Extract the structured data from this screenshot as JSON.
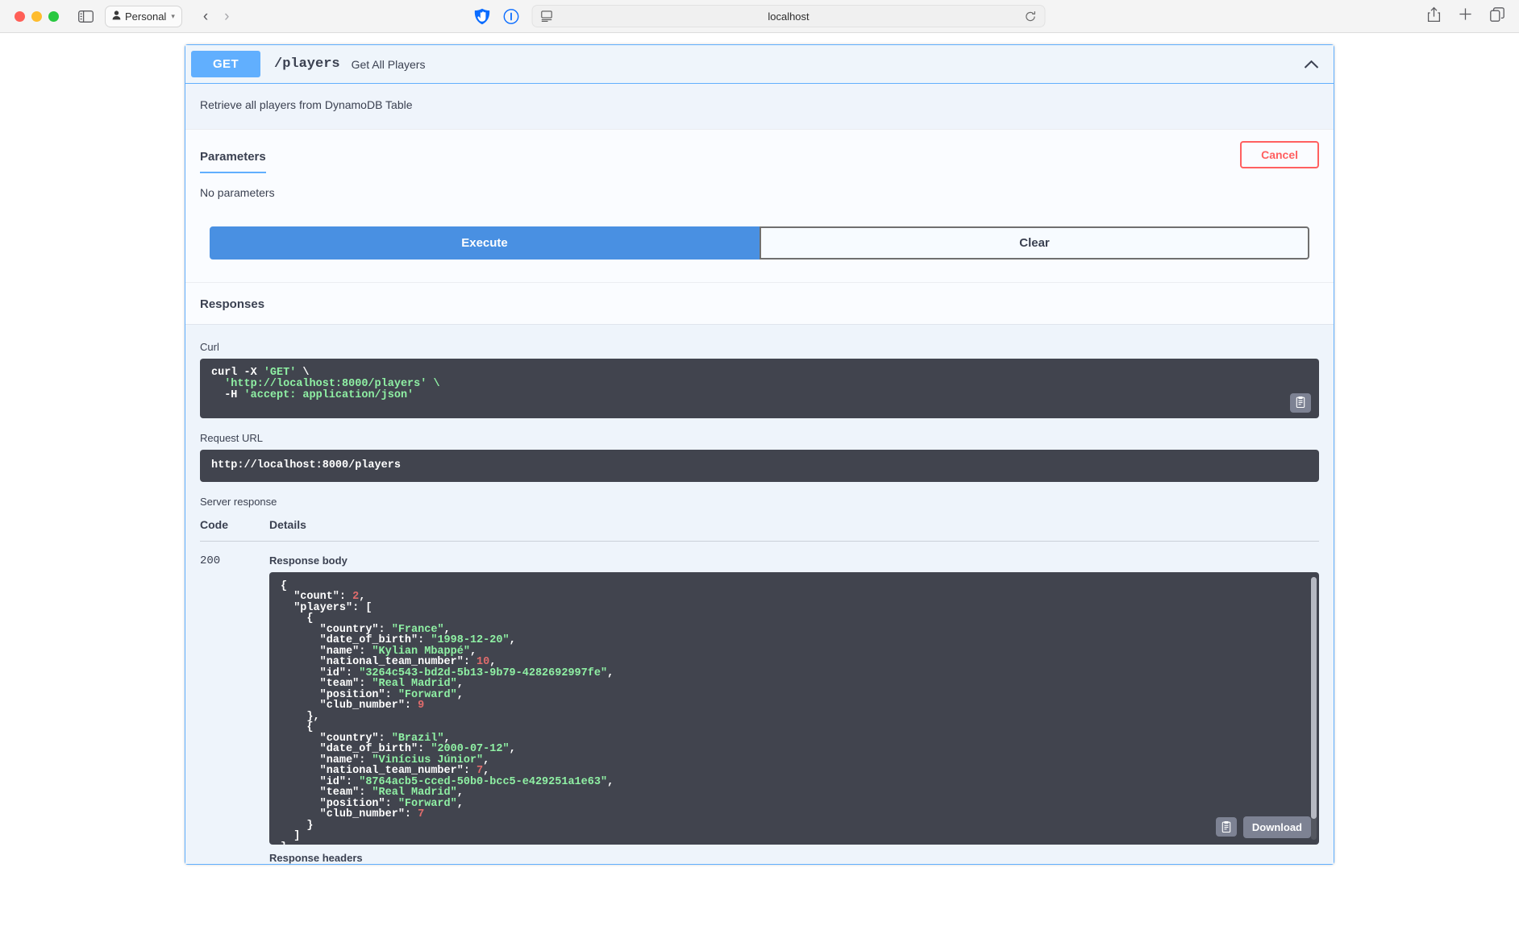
{
  "browser": {
    "profile_label": "Personal",
    "url_text": "localhost",
    "icons": {
      "sidebar": "sidebar-toggle-icon",
      "person": "person-icon",
      "chevron": "chevron-down-icon",
      "back": "back-arrow-icon",
      "forward": "forward-arrow-icon",
      "shield": "shield-icon",
      "info": "info-icon",
      "reader": "reader-view-icon",
      "reload": "reload-icon",
      "share": "share-icon",
      "new_tab": "plus-icon",
      "tab_overview": "tab-overview-icon"
    }
  },
  "operation": {
    "method": "GET",
    "path": "/players",
    "summary": "Get All Players",
    "description": "Retrieve all players from DynamoDB Table",
    "collapse_icon": "chevron-up-icon"
  },
  "parameters": {
    "tab_label": "Parameters",
    "cancel_label": "Cancel",
    "empty_text": "No parameters"
  },
  "actions": {
    "execute_label": "Execute",
    "clear_label": "Clear"
  },
  "responses": {
    "title": "Responses",
    "curl_label": "Curl",
    "curl_line1_prefix": "curl -X ",
    "curl_line1_method": "'GET'",
    "curl_line1_suffix": " \\",
    "curl_line2": "  'http://localhost:8000/players' \\",
    "curl_line3_prefix": "  -H ",
    "curl_line3_value": "'accept: application/json'",
    "request_url_label": "Request URL",
    "request_url_value": "http://localhost:8000/players",
    "server_response_label": "Server response",
    "col_code": "Code",
    "col_details": "Details",
    "status_code": "200",
    "response_body_label": "Response body",
    "response_headers_label": "Response headers",
    "download_label": "Download",
    "copy_icon": "copy-to-clipboard-icon",
    "download_icon": "download-icon"
  },
  "response_json": {
    "count": 2,
    "players": [
      {
        "country": "France",
        "date_of_birth": "1998-12-20",
        "name": "Kylian Mbappé",
        "national_team_number": 10,
        "id": "3264c543-bd2d-5b13-9b79-4282692997fe",
        "team": "Real Madrid",
        "position": "Forward",
        "club_number": 9
      },
      {
        "country": "Brazil",
        "date_of_birth": "2000-07-12",
        "name": "Vinícius Júnior",
        "national_team_number": 7,
        "id": "8764acb5-cced-50b0-bcc5-e429251a1e63",
        "team": "Real Madrid",
        "position": "Forward",
        "club_number": 7
      }
    ]
  },
  "colors": {
    "method_get": "#61affe",
    "execute": "#4990e2",
    "cancel": "#ff6060",
    "code_bg": "#41444e",
    "json_string": "#8ff0a4",
    "json_number": "#e06c6c"
  }
}
